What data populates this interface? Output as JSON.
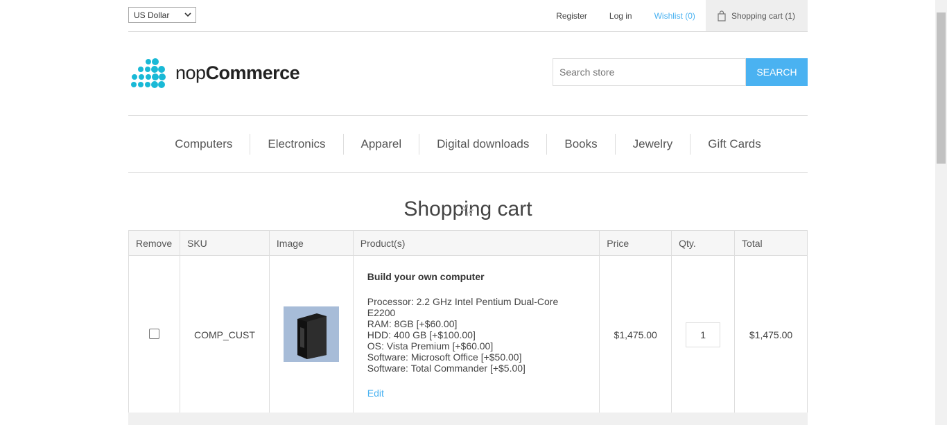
{
  "header": {
    "currency": "US Dollar",
    "links": {
      "register": "Register",
      "login": "Log in",
      "wishlist": "Wishlist (0)",
      "cart": "Shopping cart (1)"
    }
  },
  "logo": {
    "text_light": "nop",
    "text_bold": "Commerce"
  },
  "search": {
    "placeholder": "Search store",
    "button": "SEARCH"
  },
  "nav": [
    "Computers",
    "Electronics",
    "Apparel",
    "Digital downloads",
    "Books",
    "Jewelry",
    "Gift Cards"
  ],
  "page": {
    "title": "Shopping cart"
  },
  "table": {
    "headers": [
      "Remove",
      "SKU",
      "Image",
      "Product(s)",
      "Price",
      "Qty.",
      "Total"
    ],
    "rows": [
      {
        "sku": "COMP_CUST",
        "name": "Build your own computer",
        "attributes": [
          "Processor: 2.2 GHz Intel Pentium Dual-Core E2200",
          "RAM: 8GB [+$60.00]",
          "HDD: 400 GB [+$100.00]",
          "OS: Vista Premium [+$60.00]",
          "Software: Microsoft Office [+$50.00]",
          "Software: Total Commander [+$5.00]"
        ],
        "edit": "Edit",
        "price": "$1,475.00",
        "qty": "1",
        "total": "$1,475.00"
      }
    ]
  },
  "colors": {
    "accent": "#4ab2f1",
    "logo_dots": "#19b9d6"
  }
}
